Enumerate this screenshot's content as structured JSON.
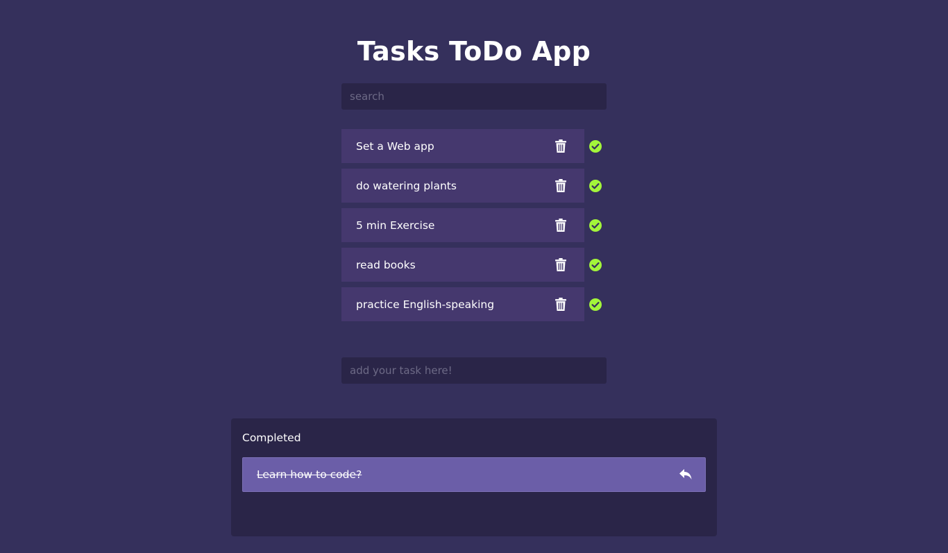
{
  "app": {
    "title": "Tasks ToDo App"
  },
  "search": {
    "placeholder": "search",
    "value": ""
  },
  "tasks": [
    {
      "label": "Set a Web app",
      "delete_icon": "trash-icon",
      "complete_icon": "check-circle-icon"
    },
    {
      "label": "do watering plants",
      "delete_icon": "trash-icon",
      "complete_icon": "check-circle-icon"
    },
    {
      "label": "5 min Exercise",
      "delete_icon": "trash-icon",
      "complete_icon": "check-circle-icon"
    },
    {
      "label": "read books",
      "delete_icon": "trash-icon",
      "complete_icon": "check-circle-icon"
    },
    {
      "label": "practice English-speaking",
      "delete_icon": "trash-icon",
      "complete_icon": "check-circle-icon"
    }
  ],
  "add_task": {
    "placeholder": "add your task here!",
    "value": ""
  },
  "completed": {
    "heading": "Completed",
    "items": [
      {
        "label": "Learn how to code?",
        "undo_icon": "undo-icon"
      }
    ]
  },
  "colors": {
    "background": "#35305c",
    "input_background": "#2a2548",
    "task_background": "#45386e",
    "completed_item_background": "#6b5ea8",
    "check_accent": "#a3f53a",
    "text": "#ffffff"
  }
}
